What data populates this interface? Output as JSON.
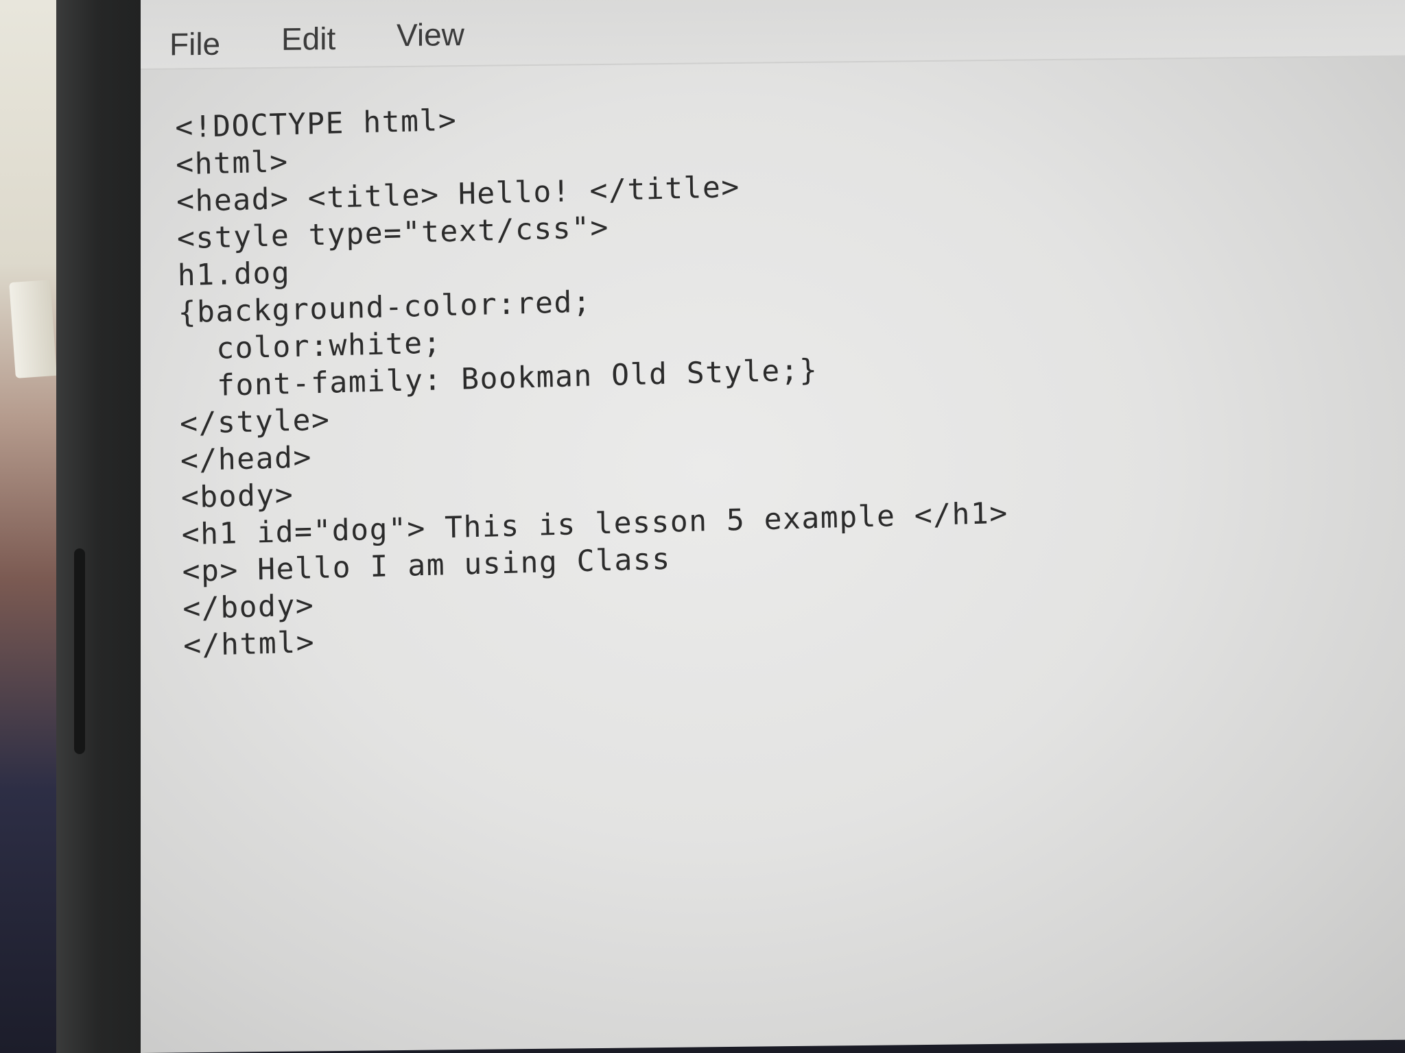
{
  "menu": {
    "file": "File",
    "edit": "Edit",
    "view": "View"
  },
  "editor": {
    "lines": [
      "<!DOCTYPE html>",
      "<html>",
      "<head> <title> Hello! </title>",
      "<style type=\"text/css\">",
      "h1.dog",
      "{background-color:red;",
      "  color:white;",
      "  font-family: Bookman Old Style;}",
      "</style>",
      "</head>",
      "<body>",
      "<h1 id=\"dog\"> This is lesson 5 example </h1>",
      "<p> Hello I am using Class",
      "</body>",
      "</html>"
    ]
  }
}
